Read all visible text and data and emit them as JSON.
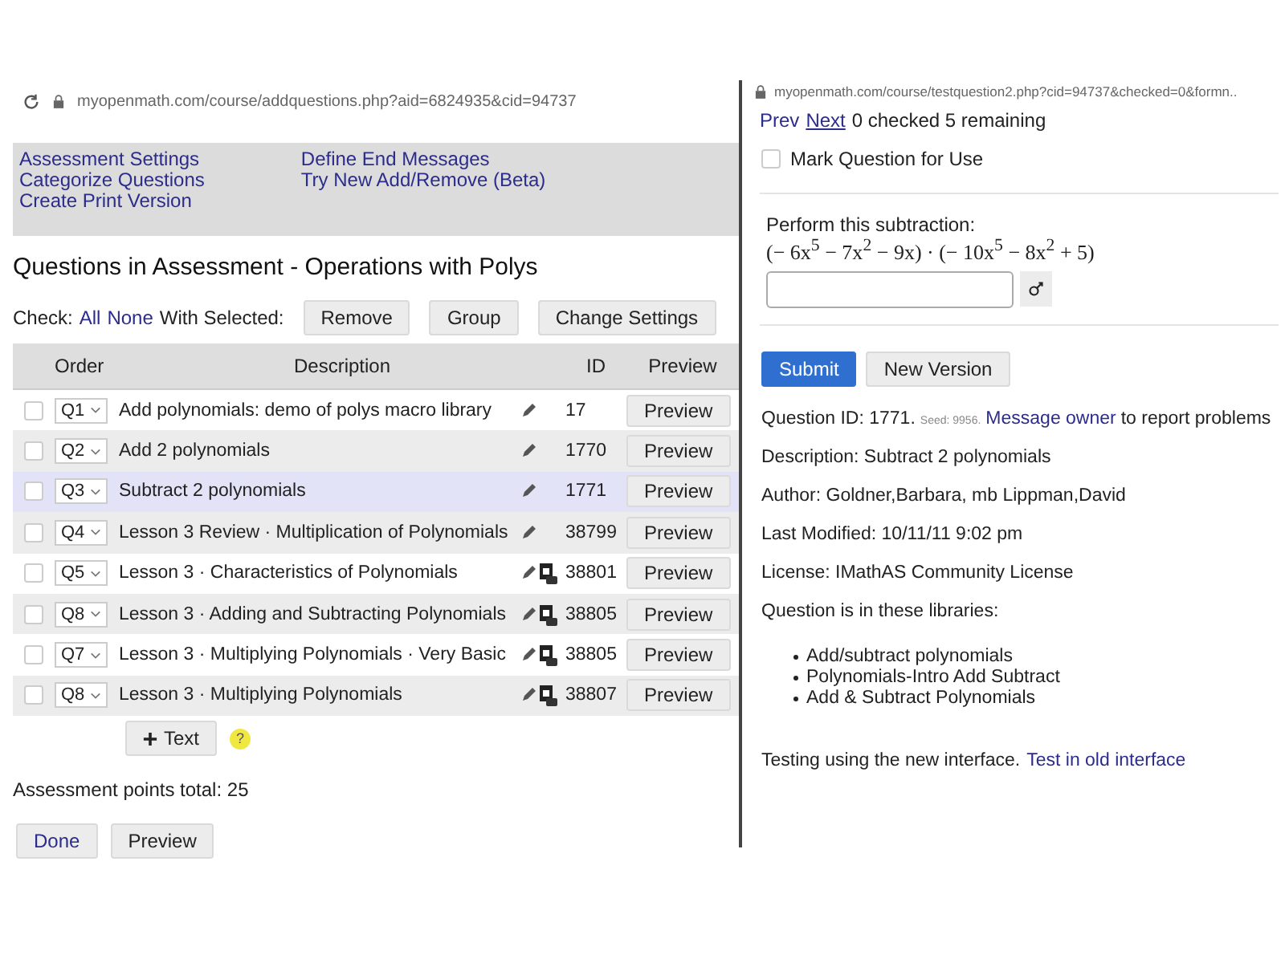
{
  "left_window": {
    "url": "myopenmath.com/course/addquestions.php?aid=6824935&cid=94737",
    "nav_links": [
      {
        "label": "Assessment Settings"
      },
      {
        "label": "Categorize Questions"
      },
      {
        "label": "Create Print Version"
      },
      {
        "label": "Define End Messages"
      },
      {
        "label": "Try New Add/Remove (Beta)"
      }
    ],
    "heading": "Questions in Assessment - Operations with Polys",
    "check_bar": {
      "label": "Check:",
      "all": "All",
      "none": "None",
      "with_selected": "With Selected:",
      "buttons": [
        "Remove",
        "Group",
        "Change Settings"
      ]
    },
    "table": {
      "columns": [
        "Order",
        "Description",
        "ID",
        "Preview"
      ],
      "rows": [
        {
          "order": "Q1",
          "description": "Add polynomials: demo of polys macro library",
          "video": false,
          "id": "17",
          "preview": "Preview",
          "checked": false,
          "selected": false
        },
        {
          "order": "Q2",
          "description": "Add 2 polynomials",
          "video": false,
          "id": "1770",
          "preview": "Preview",
          "checked": false,
          "selected": false
        },
        {
          "order": "Q3",
          "description": "Subtract 2 polynomials",
          "video": false,
          "id": "1771",
          "preview": "Preview",
          "checked": false,
          "selected": true
        },
        {
          "order": "Q4",
          "description": "Lesson 3 Review · Multiplication of Polynomials",
          "video": false,
          "id": "38799",
          "preview": "Preview",
          "checked": false,
          "selected": false
        },
        {
          "order": "Q5",
          "description": "Lesson 3 · Characteristics of Polynomials",
          "video": true,
          "id": "38801",
          "preview": "Preview",
          "checked": false,
          "selected": false
        },
        {
          "order": "Q8",
          "description": "Lesson 3 · Adding and Subtracting Polynomials",
          "video": true,
          "id": "38805",
          "preview": "Preview",
          "checked": false,
          "selected": false
        },
        {
          "order": "Q7",
          "description": "Lesson 3 · Multiplying Polynomials · Very Basic",
          "video": true,
          "id": "38805",
          "preview": "Preview",
          "checked": false,
          "selected": false
        },
        {
          "order": "Q8",
          "description": "Lesson 3 · Multiplying Polynomials",
          "video": true,
          "id": "38807",
          "preview": "Preview",
          "checked": false,
          "selected": false
        }
      ]
    },
    "add_text_button": "Text",
    "help_badge": "?",
    "points_total": "Assessment points total: 25",
    "buttons": [
      "Done",
      "Preview"
    ]
  },
  "right_window": {
    "url": "myopenmath.com/course/testquestion2.php?cid=94737&checked=0&formn..",
    "nav": {
      "prev": "Prev",
      "next": "Next",
      "status": "0 checked 5 remaining"
    },
    "mark_for_use": {
      "label": "Mark Question for Use",
      "checked": false
    },
    "question": {
      "prompt": "Perform this subtraction:",
      "expression": "(− 6x$^{5}$ − 7x$^{2}$ − 9x) · (− 10x$^{5}$ − 8x$^{2}$ + 5)"
    },
    "buttons": [
      "Submit",
      "New Version"
    ],
    "info": {
      "question_id": "Question ID: 1771.",
      "seed": "Seed: 9956.",
      "message_owner": "Message owner",
      "report": "to report problems",
      "description": "Description: Subtract 2 polynomials",
      "author": "Author: Goldner,Barbara, mb Lippman,David",
      "last_modified": "Last Modified: 10/11/11 9:02 pm",
      "license": "License: IMathAS Community License",
      "libraries_label": "Question is in these libraries:",
      "libraries": [
        "Add/subtract polynomials",
        "Polynomials-Intro Add Subtract",
        "Add & Subtract Polynomials"
      ]
    },
    "footer": {
      "text": "Testing using the new interface.",
      "link": "Test in old interface"
    }
  }
}
